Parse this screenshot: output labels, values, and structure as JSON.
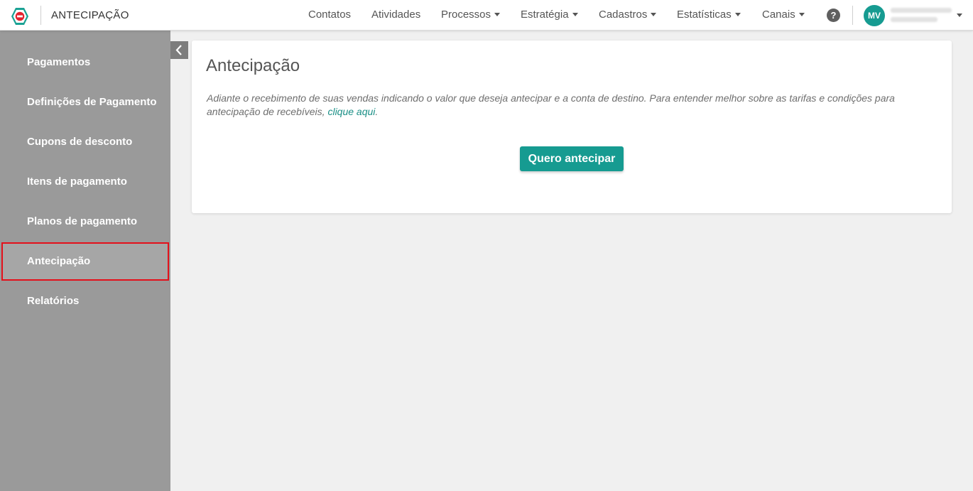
{
  "header": {
    "app_title": "ANTECIPAÇÃO",
    "nav": [
      {
        "label": "Contatos",
        "dropdown": false
      },
      {
        "label": "Atividades",
        "dropdown": false
      },
      {
        "label": "Processos",
        "dropdown": true
      },
      {
        "label": "Estratégia",
        "dropdown": true
      },
      {
        "label": "Cadastros",
        "dropdown": true
      },
      {
        "label": "Estatísticas",
        "dropdown": true
      },
      {
        "label": "Canais",
        "dropdown": true
      }
    ],
    "help_label": "?",
    "user_initials": "MV"
  },
  "sidebar": {
    "items": [
      {
        "label": "Pagamentos"
      },
      {
        "label": "Definições de Pagamento"
      },
      {
        "label": "Cupons de desconto"
      },
      {
        "label": "Itens de pagamento"
      },
      {
        "label": "Planos de pagamento"
      },
      {
        "label": "Antecipação",
        "active": true
      },
      {
        "label": "Relatórios"
      }
    ]
  },
  "main": {
    "title": "Antecipação",
    "description": "Adiante o recebimento de suas vendas indicando o valor que deseja antecipar e a conta de destino. Para entender melhor sobre as tarifas e condições para antecipação de recebíveis, ",
    "link_text": "clique aqui",
    "description_end": ".",
    "button_label": "Quero antecipar"
  },
  "colors": {
    "accent": "#169b91",
    "sidebar_bg": "#9a9a9a",
    "highlight": "#e4101a"
  },
  "icons": {
    "logo": "app-logo-icon",
    "collapse": "chevron-left-icon",
    "help": "help-icon",
    "dropdown": "caret-down-icon"
  }
}
